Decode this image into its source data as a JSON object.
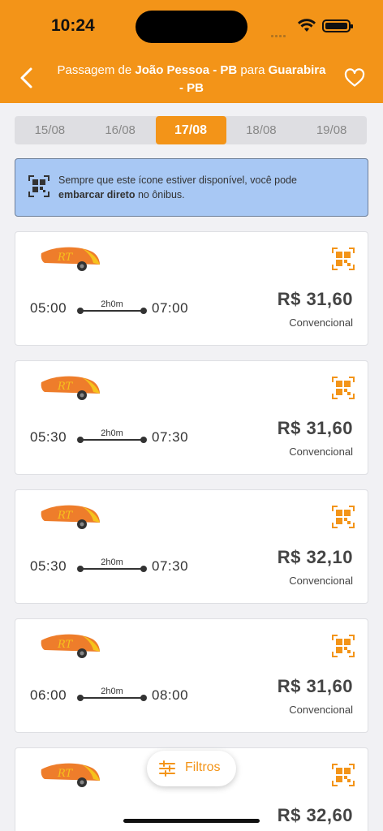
{
  "status": {
    "time": "10:24"
  },
  "header": {
    "title_prefix": "Passagem de ",
    "origin": "João Pessoa - PB",
    "middle": " para ",
    "destination": "Guarabira - PB",
    "color": "#f39418"
  },
  "dates": [
    "15/08",
    "16/08",
    "17/08",
    "18/08",
    "19/08"
  ],
  "selected_date": "17/08",
  "info": {
    "line1": "Sempre que este ícone estiver disponível, você pode",
    "bold": "embarcar direto",
    "line2_rest": " no ônibus."
  },
  "trips": [
    {
      "departure": "05:00",
      "arrival": "07:00",
      "duration": "2h0m",
      "price": "R$ 31,60",
      "class": "Convencional"
    },
    {
      "departure": "05:30",
      "arrival": "07:30",
      "duration": "2h0m",
      "price": "R$ 31,60",
      "class": "Convencional"
    },
    {
      "departure": "05:30",
      "arrival": "07:30",
      "duration": "2h0m",
      "price": "R$ 32,10",
      "class": "Convencional"
    },
    {
      "departure": "06:00",
      "arrival": "08:00",
      "duration": "2h0m",
      "price": "R$ 31,60",
      "class": "Convencional"
    },
    {
      "departure": "",
      "arrival": "",
      "duration": "",
      "price": "R$ 32,60",
      "class": ""
    }
  ],
  "filter": {
    "label": "Filtros"
  },
  "icons": {
    "back": "chevron-left-icon",
    "favorite": "heart-icon",
    "board_direct": "qr-code-icon",
    "filter": "sliders-icon"
  }
}
